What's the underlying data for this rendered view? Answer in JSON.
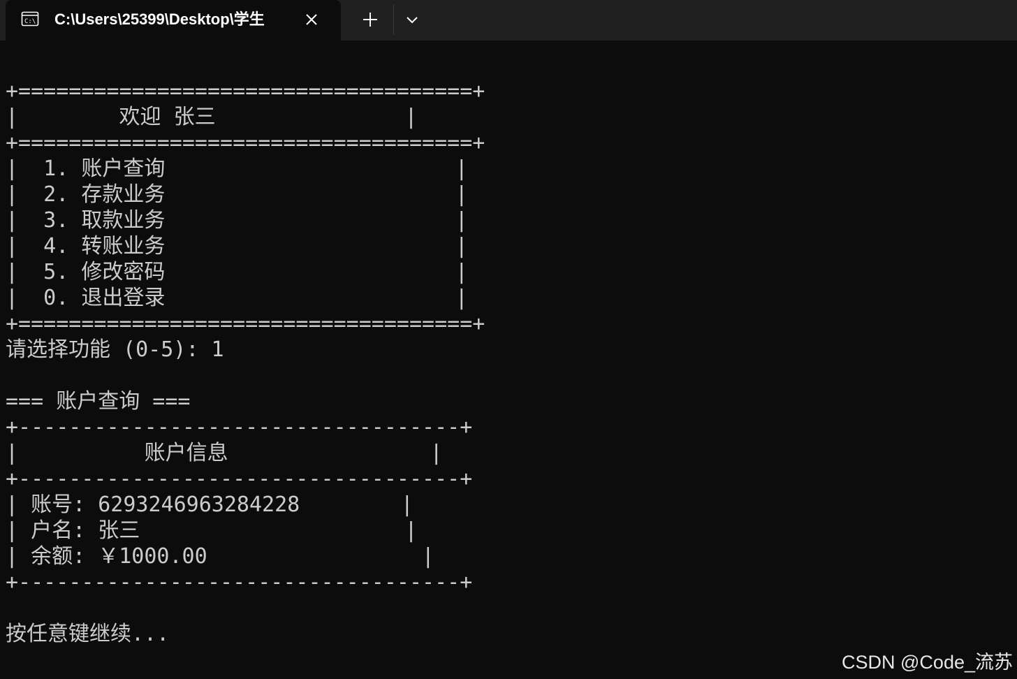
{
  "window": {
    "tab_title": "C:\\Users\\25399\\Desktop\\学生",
    "tab_icon": "terminal-icon",
    "close_icon": "close-icon",
    "new_tab_icon": "plus-icon",
    "dropdown_icon": "chevron-down-icon"
  },
  "console": {
    "lines": [
      "+====================================+",
      "|        欢迎 张三               |",
      "+====================================+",
      "|  1. 账户查询                       |",
      "|  2. 存款业务                       |",
      "|  3. 取款业务                       |",
      "|  4. 转账业务                       |",
      "|  5. 修改密码                       |",
      "|  0. 退出登录                       |",
      "+====================================+",
      "请选择功能 (0-5): 1",
      "",
      "=== 账户查询 ===",
      "+-----------------------------------+",
      "|          账户信息                |",
      "+-----------------------------------+",
      "| 账号: 6293246963284228        |",
      "| 户名: 张三                     |",
      "| 余额: ￥1000.00                 |",
      "+-----------------------------------+",
      "",
      "按任意键继续..."
    ]
  },
  "watermark": "CSDN @Code_流苏",
  "colors": {
    "background": "#0c0c0c",
    "titlebar": "#202020",
    "text": "#cccccc"
  }
}
